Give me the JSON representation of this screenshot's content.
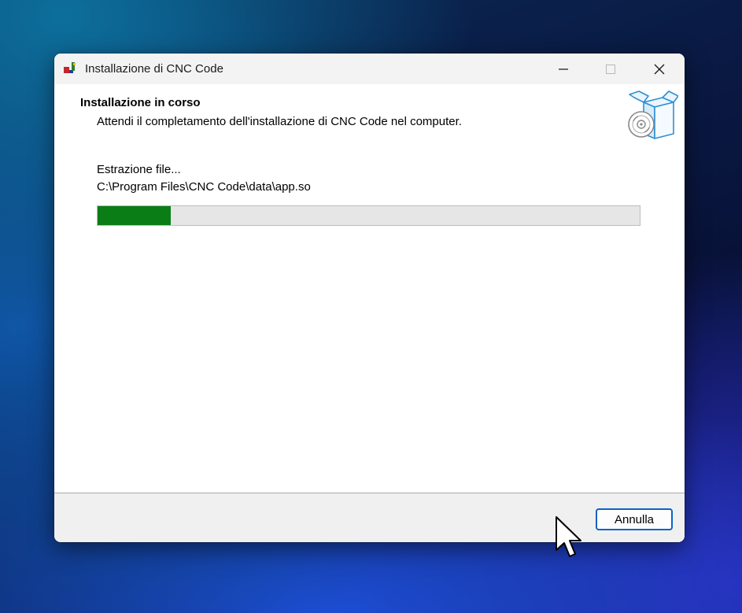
{
  "window": {
    "title": "Installazione di CNC Code",
    "app_icon": "installer-app-icon",
    "controls": [
      "minimize-icon",
      "maximize-icon",
      "close-icon"
    ]
  },
  "header": {
    "title": "Installazione in corso",
    "subtitle": "Attendi il completamento dell'installazione di CNC Code nel computer.",
    "icon": "setup-box-disc-icon"
  },
  "main": {
    "status": "Estrazione file...",
    "current_file": "C:\\Program Files\\CNC Code\\data\\app.so",
    "progress_percent": 13.5,
    "progress_color": "#0b7d17"
  },
  "footer": {
    "cancel_label": "Annulla",
    "accent_color": "#0a64c4"
  },
  "cursor": "mouse-pointer-icon"
}
